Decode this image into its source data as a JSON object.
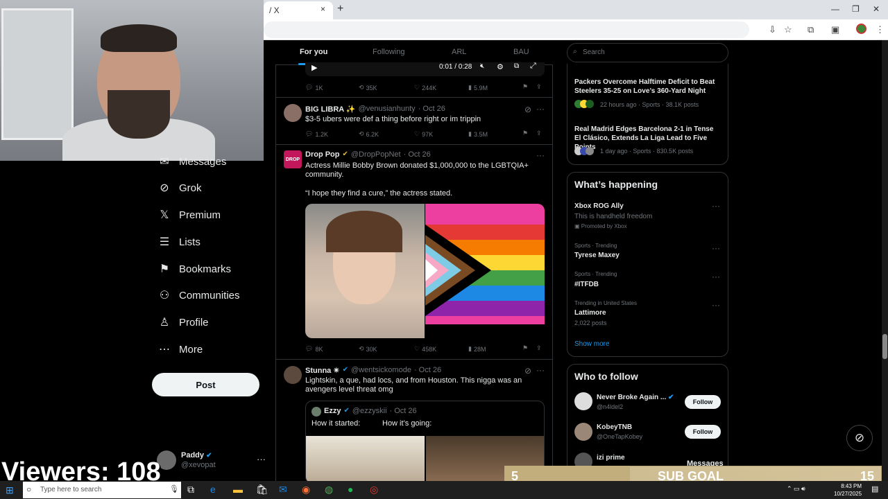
{
  "browser": {
    "tab_title": "/ X",
    "tab_close": "×",
    "new_tab": "+",
    "window_buttons": [
      "—",
      "❐",
      "✕"
    ]
  },
  "stream": {
    "viewers": "Viewers: 108",
    "sub_goal": {
      "current": "5",
      "label": "SUB GOAL",
      "target": "15",
      "fraction": 0.333
    }
  },
  "nav": {
    "items": [
      {
        "label": "Messages",
        "icon": "envelope-icon",
        "glyph": "✉"
      },
      {
        "label": "Grok",
        "icon": "grok-icon",
        "glyph": "⊘"
      },
      {
        "label": "Premium",
        "icon": "x-logo-icon",
        "glyph": "𝕏"
      },
      {
        "label": "Lists",
        "icon": "list-icon",
        "glyph": "☰"
      },
      {
        "label": "Bookmarks",
        "icon": "bookmark-icon",
        "glyph": "⚑"
      },
      {
        "label": "Communities",
        "icon": "communities-icon",
        "glyph": "⚇"
      },
      {
        "label": "Profile",
        "icon": "profile-icon",
        "glyph": "♙"
      },
      {
        "label": "More",
        "icon": "more-circle-icon",
        "glyph": "⋯"
      }
    ],
    "post_label": "Post",
    "account": {
      "name": "Paddy",
      "handle": "@xevopat",
      "more": "···"
    }
  },
  "feed": {
    "tabs": [
      "For you",
      "Following",
      "ARL",
      "BAU"
    ],
    "video": {
      "time": "0:01 / 0:28"
    },
    "tweet0": {
      "replies": "1K",
      "retweets": "35K",
      "likes": "244K",
      "views": "5.9M"
    },
    "tweet1": {
      "name": "BIG LIBRA ✨",
      "handle": "@venusianhunty",
      "date": "· Oct 26",
      "text": "$3-5 ubers were def a thing before right or im trippin",
      "replies": "1.2K",
      "retweets": "6.2K",
      "likes": "97K",
      "views": "3.5M"
    },
    "tweet2": {
      "name": "Drop Pop",
      "handle": "@DropPopNet",
      "date": "· Oct 26",
      "text1": "Actress Millie Bobby Brown donated $1,000,000 to the LGBTQIA+ community.",
      "text2": "“I hope they find a cure,” the actress stated.",
      "replies": "8K",
      "retweets": "30K",
      "likes": "458K",
      "views": "28M"
    },
    "tweet3": {
      "name": "Stunna ✴",
      "handle": "@wentsickomode",
      "date": "· Oct 26",
      "text": "Lightskin, a que, had locs, and from Houston. This nigga was an avengers level threat omg",
      "quote": {
        "name": "Ezzy",
        "handle": "@ezzyskii",
        "date": "· Oct 26",
        "left": "How it started:",
        "right": "How it’s going:"
      }
    }
  },
  "right": {
    "search_placeholder": "Search",
    "news": [
      {
        "title": "Packers Overcome Halftime Deficit to Beat Steelers 35-25 on Love’s 360-Yard Night",
        "meta": "22 hours ago · Sports · 38.1K posts"
      },
      {
        "title": "Real Madrid Edges Barcelona 2-1 in Tense El Clásico, Extends La Liga Lead to Five Points",
        "meta": "1 day ago · Sports · 830.5K posts"
      }
    ],
    "happening": {
      "title": "What’s happening",
      "items": [
        {
          "context": "",
          "title": "Xbox ROG Ally",
          "sub": "This is handheld freedom",
          "promo": "Promoted by Xbox"
        },
        {
          "context": "Sports · Trending",
          "title": "Tyrese Maxey",
          "sub": "",
          "promo": ""
        },
        {
          "context": "Sports · Trending",
          "title": "#ITFDB",
          "sub": "",
          "promo": ""
        },
        {
          "context": "Trending in United States",
          "title": "Lattimore",
          "sub": "2,022 posts",
          "promo": ""
        }
      ],
      "show_more": "Show more"
    },
    "who": {
      "title": "Who to follow",
      "follow": "Follow",
      "people": [
        {
          "name": "Never Broke Again ...",
          "handle": "@n4ldel2"
        },
        {
          "name": "KobeyTNB",
          "handle": "@OneTapKobey"
        },
        {
          "name": "izi prime",
          "handle": ""
        }
      ]
    },
    "messages_label": "Messages"
  },
  "taskbar": {
    "search_placeholder": "Type here to search",
    "time": "8:43 PM",
    "date": "10/27/2025"
  }
}
